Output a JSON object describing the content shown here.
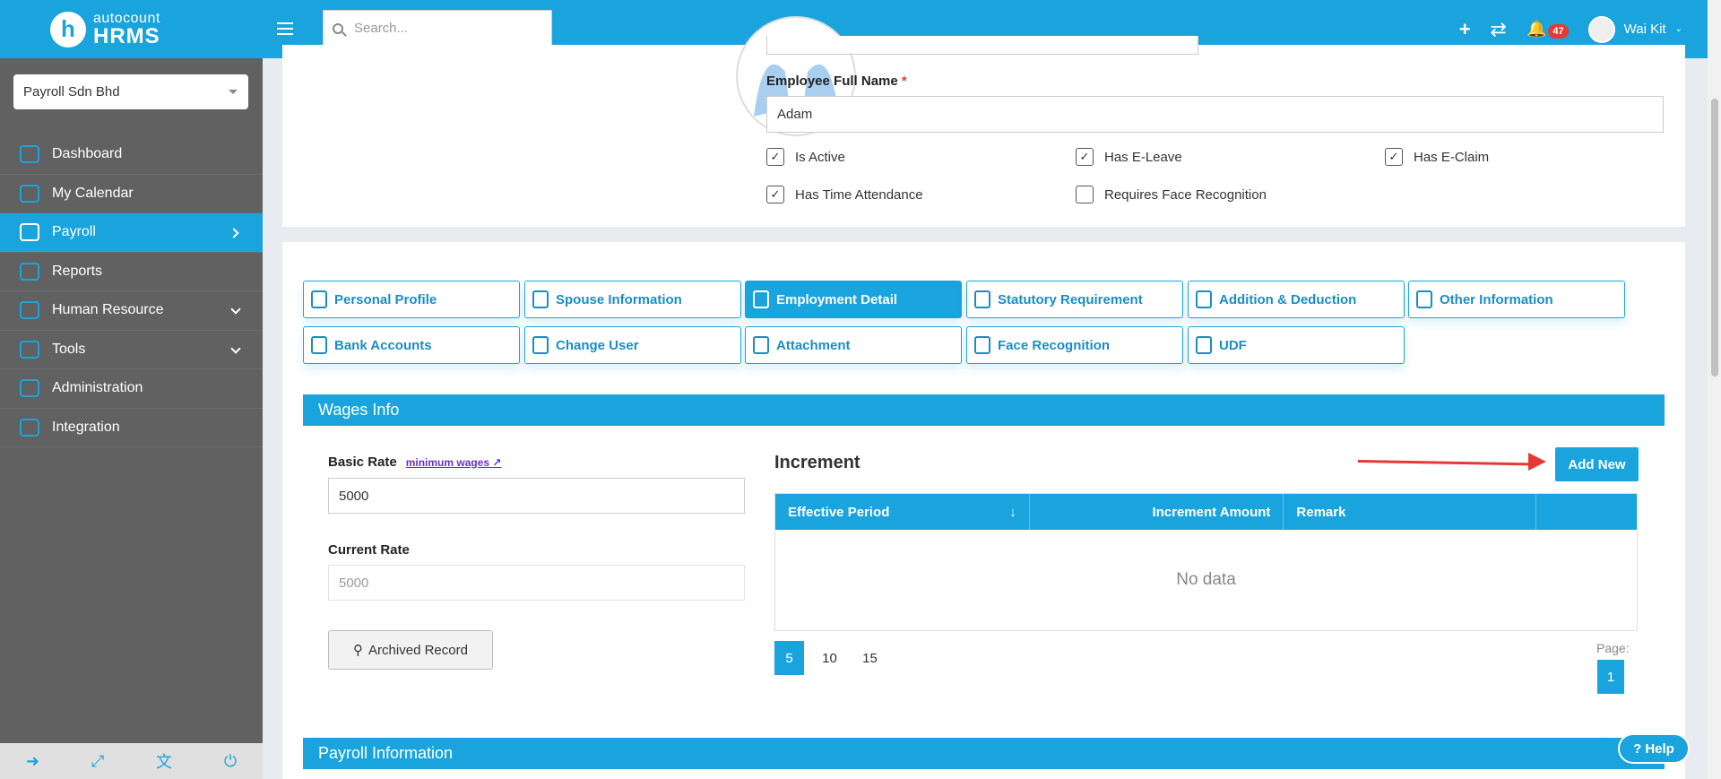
{
  "brand": {
    "logo_letter": "h",
    "line1": "autocount",
    "line2": "HRMS"
  },
  "company_select": {
    "value": "Payroll Sdn Bhd"
  },
  "sidebar": {
    "items": [
      {
        "label": "Dashboard",
        "icon": "dashboard-icon"
      },
      {
        "label": "My Calendar",
        "icon": "calendar-icon"
      },
      {
        "label": "Payroll",
        "icon": "payroll-icon",
        "active": true
      },
      {
        "label": "Reports",
        "icon": "reports-icon"
      },
      {
        "label": "Human Resource",
        "icon": "human-resource-icon"
      },
      {
        "label": "Tools",
        "icon": "tools-icon"
      },
      {
        "label": "Administration",
        "icon": "administration-icon"
      },
      {
        "label": "Integration",
        "icon": "integration-icon"
      }
    ]
  },
  "topbar": {
    "search_placeholder": "Search...",
    "notification_count": "47",
    "user_name": "Wai Kit"
  },
  "employee": {
    "full_name_label": "Employee Full Name",
    "required_mark": "*",
    "full_name_value": "Adam",
    "checkboxes": [
      {
        "label": "Is Active",
        "checked": true
      },
      {
        "label": "Has E-Leave",
        "checked": true
      },
      {
        "label": "Has E-Claim",
        "checked": true
      },
      {
        "label": "Has Time Attendance",
        "checked": true
      },
      {
        "label": "Requires Face Recognition",
        "checked": false
      }
    ]
  },
  "tabs": [
    {
      "label": "Personal Profile"
    },
    {
      "label": "Spouse Information"
    },
    {
      "label": "Employment Detail",
      "active": true
    },
    {
      "label": "Statutory Requirement"
    },
    {
      "label": "Addition & Deduction"
    },
    {
      "label": "Other Information"
    },
    {
      "label": "Bank Accounts"
    },
    {
      "label": "Change User"
    },
    {
      "label": "Attachment"
    },
    {
      "label": "Face Recognition"
    },
    {
      "label": "UDF"
    }
  ],
  "wages": {
    "section_title": "Wages Info",
    "basic_rate_label": "Basic Rate",
    "min_wage_link": "minimum wages",
    "basic_rate_value": "5000",
    "current_rate_label": "Current Rate",
    "current_rate_value": "5000",
    "archived_label": "Archived Record"
  },
  "increment": {
    "title": "Increment",
    "add_new_label": "Add New",
    "columns": [
      "Effective Period",
      "Increment Amount",
      "Remark"
    ],
    "empty_text": "No data",
    "page_sizes": [
      "5",
      "10",
      "15"
    ],
    "page_label": "Page:",
    "current_page": "1"
  },
  "payroll_section_title": "Payroll Information",
  "help_label": "Help",
  "colors": {
    "accent": "#1aa4dd",
    "sidebar": "#616161",
    "arrow": "#e53935"
  }
}
